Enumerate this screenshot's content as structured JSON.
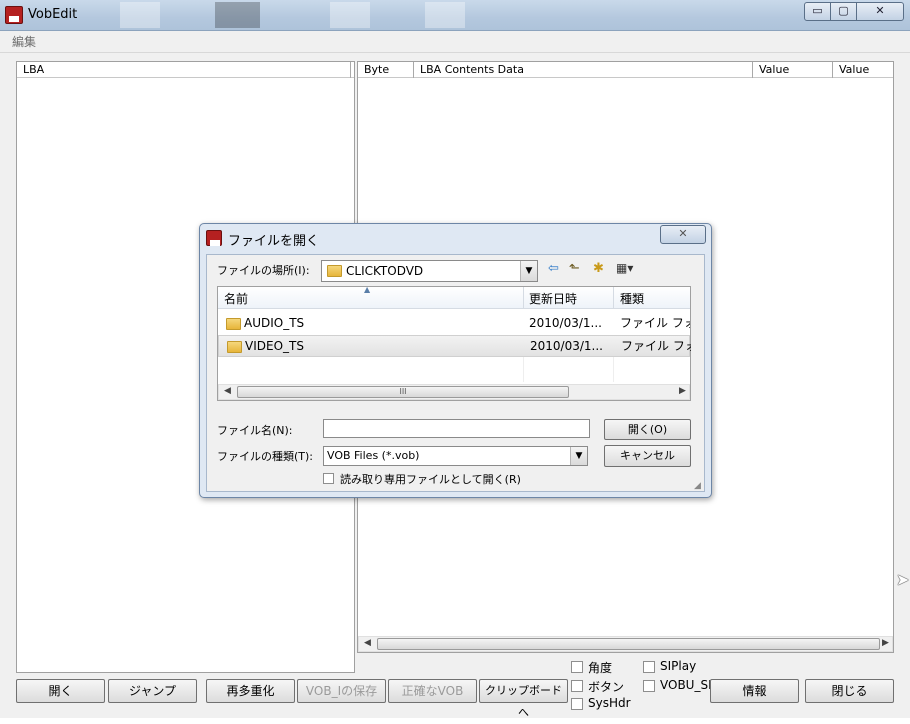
{
  "window": {
    "title": "VobEdit",
    "controls": {
      "minimize": "▭",
      "maximize": "▢",
      "close": "✕"
    }
  },
  "menu": {
    "items": [
      "編集"
    ]
  },
  "left_panel": {
    "columns": [
      "LBA"
    ]
  },
  "right_panel": {
    "columns": [
      "Byte",
      "LBA Contents Data",
      "Value",
      "Value"
    ]
  },
  "bottom": {
    "buttons": {
      "open": "開く",
      "jump": "ジャンプ",
      "remux": "再多重化",
      "save_vob_i": "VOB_Iの保存",
      "exact_vob": "正確なVOB",
      "clipboard": "クリップボードへ",
      "info": "情報",
      "close": "閉じる"
    },
    "checkboxes": {
      "angle": "角度",
      "button": "ボタン",
      "syshdr": "SysHdr",
      "siplay": "SIPlay",
      "vobu_sr": "VOBU_SR"
    }
  },
  "dialog": {
    "title": "ファイルを開く",
    "close": "✕",
    "location_label": "ファイルの場所(I):",
    "location_value": "CLICKTODVD",
    "toolbar_icons": [
      "back-icon",
      "up-folder-icon",
      "new-folder-icon",
      "view-menu-icon"
    ],
    "list_columns": [
      "名前",
      "更新日時",
      "種類"
    ],
    "files": [
      {
        "name": "AUDIO_TS",
        "date": "2010/03/1...",
        "type": "ファイル フォ"
      },
      {
        "name": "VIDEO_TS",
        "date": "2010/03/1...",
        "type": "ファイル フォ"
      }
    ],
    "filename_label": "ファイル名(N):",
    "filename_value": "",
    "filetype_label": "ファイルの種類(T):",
    "filetype_value": "VOB Files (*.vob)",
    "readonly_label": "読み取り専用ファイルとして開く(R)",
    "open_button": "開く(O)",
    "cancel_button": "キャンセル",
    "scroll_grip": "III"
  },
  "colors": {
    "titlebar": "#b4c8de",
    "dialog_frame": "#dfe8f3",
    "selection": "#e8e8e8"
  }
}
